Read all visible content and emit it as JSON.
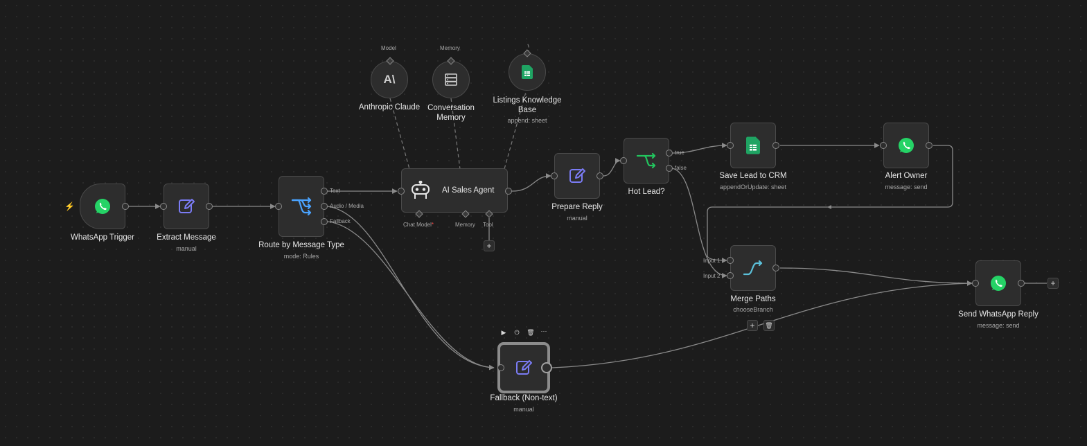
{
  "colors": {
    "canvas": "#1c1c1c",
    "node_bg": "#2d2d2d",
    "whatsapp": "#25d366",
    "edit_icon": "#7b7cf5",
    "switch_icon": "#4aa3ff",
    "if_icon": "#22c55e",
    "merge_icon": "#5bc0d9",
    "sheets": "#1fa463",
    "trigger_bolt": "#ff6d2c"
  },
  "nodes": {
    "whatsapp_trigger": {
      "title": "WhatsApp Trigger",
      "icon": "whatsapp-icon"
    },
    "extract_message": {
      "title": "Extract Message",
      "subtitle": "manual",
      "icon": "edit-icon"
    },
    "route": {
      "title": "Route by Message Type",
      "subtitle": "mode: Rules",
      "icon": "switch-icon",
      "outputs": [
        "Text",
        "Audio / Media",
        "Fallback"
      ]
    },
    "ai_agent": {
      "title": "AI Sales Agent",
      "icon": "robot-icon",
      "ports": {
        "chat_model": "Chat Model",
        "chat_model_required": "*",
        "memory": "Memory",
        "tool": "Tool"
      }
    },
    "anthropic": {
      "title": "Anthropic Claude",
      "port_label": "Model",
      "icon": "anthropic-icon",
      "logo_text": "A\\"
    },
    "memory": {
      "title": "Conversation Memory",
      "port_label": "Memory",
      "icon": "database-icon"
    },
    "listings": {
      "title": "Listings Knowledge Base",
      "subtitle": "append: sheet",
      "icon": "sheets-icon"
    },
    "prepare_reply": {
      "title": "Prepare Reply",
      "subtitle": "manual",
      "icon": "edit-icon"
    },
    "hot_lead": {
      "title": "Hot Lead?",
      "icon": "if-icon",
      "outputs": [
        "true",
        "false"
      ]
    },
    "save_lead": {
      "title": "Save Lead to CRM",
      "subtitle": "appendOrUpdate: sheet",
      "icon": "sheets-icon"
    },
    "alert_owner": {
      "title": "Alert Owner",
      "subtitle": "message: send",
      "icon": "whatsapp-icon"
    },
    "merge": {
      "title": "Merge Paths",
      "subtitle": "chooseBranch",
      "icon": "merge-icon",
      "inputs": [
        "Input 1",
        "Input 2"
      ]
    },
    "send_reply": {
      "title": "Send WhatsApp Reply",
      "subtitle": "message: send",
      "icon": "whatsapp-icon"
    },
    "fallback": {
      "title": "Fallback (Non-text)",
      "subtitle": "manual",
      "icon": "edit-icon"
    }
  },
  "controls": {
    "plus": "+",
    "bolt": "⚡",
    "toolbar": {
      "play": "▶",
      "power": "⏻",
      "delete": "🗑",
      "more": "···"
    },
    "trash": "🗑"
  }
}
